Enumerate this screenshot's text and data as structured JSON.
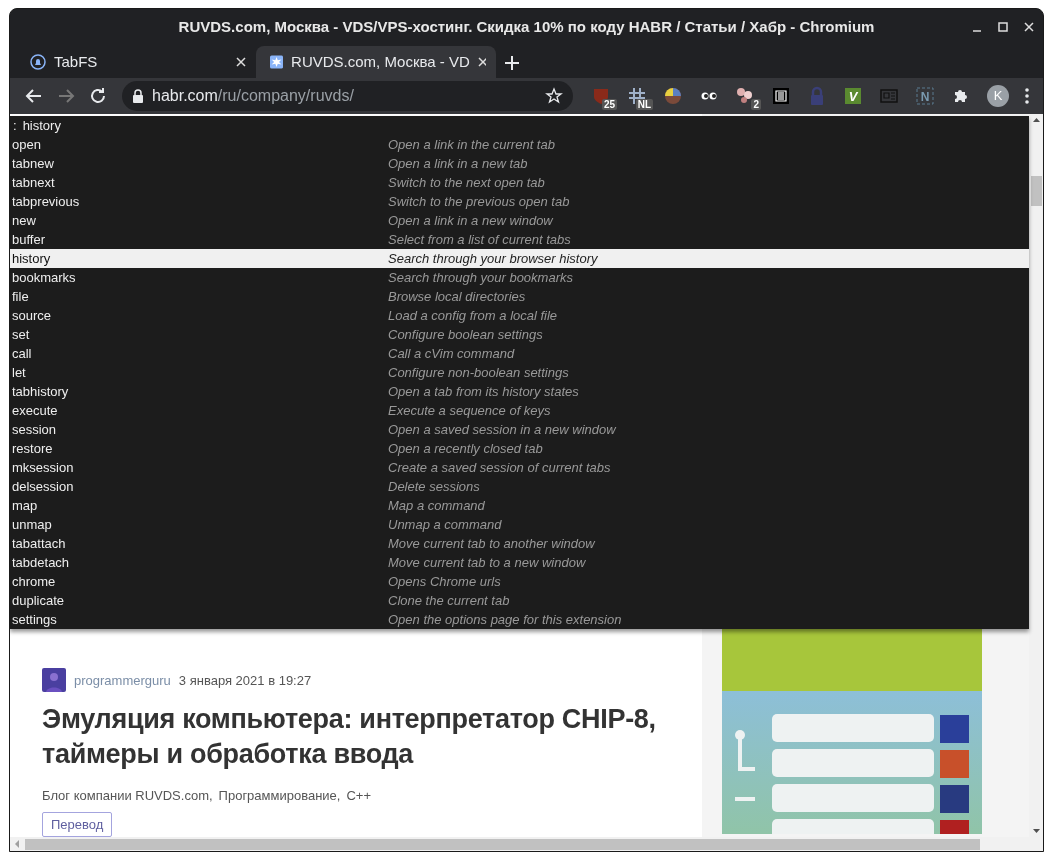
{
  "window": {
    "title": "RUVDS.com, Москва - VDS/VPS-хостинг. Скидка 10% по коду HABR / Статьи / Хабр - Chromium"
  },
  "tabs": [
    {
      "title": "TabFS",
      "kind": "bell",
      "selected": false
    },
    {
      "title": "RUVDS.com, Москва - VD",
      "kind": "burst",
      "selected": true
    }
  ],
  "address_bar": {
    "host": "habr.com",
    "path": "/ru/company/ruvds/"
  },
  "extensions": [
    {
      "kind": "shield",
      "badge": "25"
    },
    {
      "kind": "grid",
      "badge": "NL"
    },
    {
      "kind": "pie"
    },
    {
      "kind": "eyes"
    },
    {
      "kind": "dots",
      "badge": "2"
    },
    {
      "kind": "bin"
    },
    {
      "kind": "lock"
    },
    {
      "kind": "letter",
      "label": "V"
    },
    {
      "kind": "news"
    },
    {
      "kind": "frame",
      "label": "N"
    },
    {
      "kind": "puzzle"
    }
  ],
  "profile": {
    "initial": "K"
  },
  "command_bar": {
    "prompt": ":",
    "value": "history"
  },
  "commands": [
    {
      "name": "open",
      "description": "Open a link in the current tab",
      "selected": false
    },
    {
      "name": "tabnew",
      "description": "Open a link in a new tab",
      "selected": false
    },
    {
      "name": "tabnext",
      "description": "Switch to the next open tab",
      "selected": false
    },
    {
      "name": "tabprevious",
      "description": "Switch to the previous open tab",
      "selected": false
    },
    {
      "name": "new",
      "description": "Open a link in a new window",
      "selected": false
    },
    {
      "name": "buffer",
      "description": "Select from a list of current tabs",
      "selected": false
    },
    {
      "name": "history",
      "description": "Search through your browser history",
      "selected": true
    },
    {
      "name": "bookmarks",
      "description": "Search through your bookmarks",
      "selected": false
    },
    {
      "name": "file",
      "description": "Browse local directories",
      "selected": false
    },
    {
      "name": "source",
      "description": "Load a config from a local file",
      "selected": false
    },
    {
      "name": "set",
      "description": "Configure boolean settings",
      "selected": false
    },
    {
      "name": "call",
      "description": "Call a cVim command",
      "selected": false
    },
    {
      "name": "let",
      "description": "Configure non-boolean settings",
      "selected": false
    },
    {
      "name": "tabhistory",
      "description": "Open a tab from its history states",
      "selected": false
    },
    {
      "name": "execute",
      "description": "Execute a sequence of keys",
      "selected": false
    },
    {
      "name": "session",
      "description": "Open a saved session in a new window",
      "selected": false
    },
    {
      "name": "restore",
      "description": "Open a recently closed tab",
      "selected": false
    },
    {
      "name": "mksession",
      "description": "Create a saved session of current tabs",
      "selected": false
    },
    {
      "name": "delsession",
      "description": "Delete sessions",
      "selected": false
    },
    {
      "name": "map",
      "description": "Map a command",
      "selected": false
    },
    {
      "name": "unmap",
      "description": "Unmap a command",
      "selected": false
    },
    {
      "name": "tabattach",
      "description": "Move current tab to another window",
      "selected": false
    },
    {
      "name": "tabdetach",
      "description": "Move current tab to a new window",
      "selected": false
    },
    {
      "name": "chrome",
      "description": "Opens Chrome urls",
      "selected": false
    },
    {
      "name": "duplicate",
      "description": "Clone the current tab",
      "selected": false
    },
    {
      "name": "settings",
      "description": "Open the options page for this extension",
      "selected": false
    }
  ],
  "article": {
    "author": "programmerguru",
    "date": "3 января 2021 в 19:27",
    "title": "Эмуляция компьютера: интерпретатор CHIP-8, таймеры и обработка ввода",
    "hubs": [
      "Блог компании RUVDS.com,",
      "Программирование,",
      "C++"
    ],
    "label": "Перевод"
  }
}
